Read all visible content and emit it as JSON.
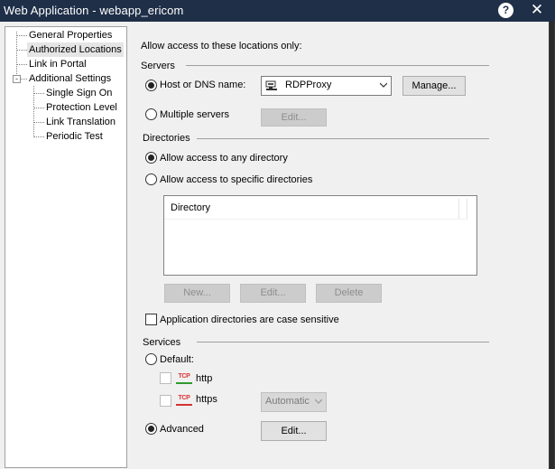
{
  "window": {
    "title": "Web Application - webapp_ericom",
    "help_icon": "?",
    "close_icon": "✕"
  },
  "tree": {
    "items": [
      {
        "label": "General Properties"
      },
      {
        "label": "Authorized Locations",
        "selected": true
      },
      {
        "label": "Link in Portal"
      },
      {
        "label": "Additional Settings",
        "expander": "-"
      },
      {
        "label": "Single Sign On"
      },
      {
        "label": "Protection Level"
      },
      {
        "label": "Link Translation"
      },
      {
        "label": "Periodic Test"
      }
    ]
  },
  "main": {
    "intro": "Allow access to these locations only:",
    "servers": {
      "group_label": "Servers",
      "host_radio_label": "Host or DNS name:",
      "host_selected": true,
      "host_value": "RDPProxy",
      "host_icon": "server-icon",
      "manage_label": "Manage...",
      "multiple_radio_label": "Multiple servers",
      "multiple_edit_label": "Edit..."
    },
    "directories": {
      "group_label": "Directories",
      "any_label": "Allow access to any directory",
      "any_selected": true,
      "specific_label": "Allow access to specific directories",
      "column_header": "Directory",
      "new_label": "New...",
      "edit_label": "Edit...",
      "delete_label": "Delete",
      "case_label": "Application directories are case sensitive"
    },
    "services": {
      "group_label": "Services",
      "default_label": "Default:",
      "http_label": "http",
      "https_label": "https",
      "tcp_badge": "TCP",
      "https_mode": "Automatic",
      "advanced_label": "Advanced",
      "advanced_selected": true,
      "advanced_edit_label": "Edit..."
    }
  },
  "colors": {
    "titlebar": "#1f2f48",
    "http_bar": "#2e9b2e",
    "https_bar": "#d33333"
  }
}
